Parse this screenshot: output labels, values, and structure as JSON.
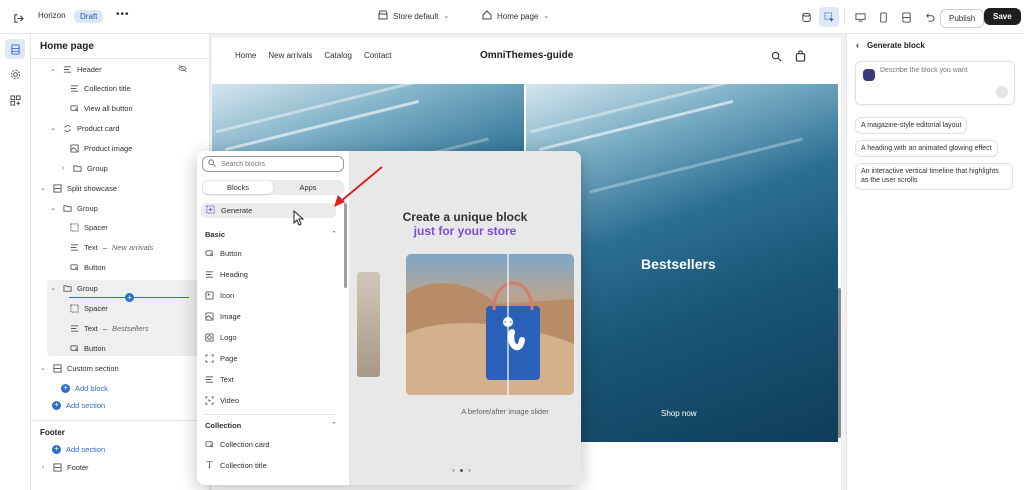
{
  "topbar": {
    "store_name": "Horizon",
    "status_badge": "Draft",
    "store_selector": "Store default",
    "page_selector": "Home page",
    "publish_label": "Publish",
    "save_label": "Save"
  },
  "sidebar": {
    "title": "Home page",
    "items": [
      {
        "label": "Header"
      },
      {
        "label": "Collection title"
      },
      {
        "label": "View all button"
      },
      {
        "label": "Product card"
      },
      {
        "label": "Product image"
      },
      {
        "label": "Group"
      },
      {
        "label": "Split showcase"
      },
      {
        "label": "Group"
      },
      {
        "label": "Spacer"
      },
      {
        "label": "Text",
        "sub": "New arrivals"
      },
      {
        "label": "Button"
      },
      {
        "label": "Group"
      },
      {
        "label": "Spacer"
      },
      {
        "label": "Text",
        "sub": "Bestsellers"
      },
      {
        "label": "Button"
      },
      {
        "label": "Custom section"
      }
    ],
    "add_block_label": "Add block",
    "add_section_label": "Add section",
    "footer_title": "Footer",
    "footer_add_section_label": "Add section",
    "footer_item_label": "Footer"
  },
  "canvas": {
    "nav": [
      "Home",
      "New arrivals",
      "Catalog",
      "Contact"
    ],
    "logo": "OmniThemes-guide",
    "hero_title": "Bestsellers",
    "hero_cta": "Shop now"
  },
  "picker": {
    "search_placeholder": "Search blocks",
    "tabs": [
      "Blocks",
      "Apps"
    ],
    "generate_label": "Generate",
    "basic_title": "Basic",
    "basic_items": [
      "Button",
      "Heading",
      "Icon",
      "Image",
      "Logo",
      "Page",
      "Text",
      "Video"
    ],
    "collection_title": "Collection",
    "collection_items": [
      "Collection card",
      "Collection title"
    ],
    "promo_line1": "Create a unique block",
    "promo_line2": "just for your store",
    "promo_caption": "A before/after image slider"
  },
  "right_panel": {
    "title": "Generate block",
    "input_placeholder": "Describe the block you want",
    "suggestions": [
      "A magazine-style editorial layout",
      "A heading with an animated glowing effect",
      "An interactive vertical timeline that highlights as the user scrolls"
    ]
  },
  "colors": {
    "accent": "#2c6ecb",
    "promo_purple": "#7b4fd9",
    "annotation_arrow": "#e02020"
  }
}
